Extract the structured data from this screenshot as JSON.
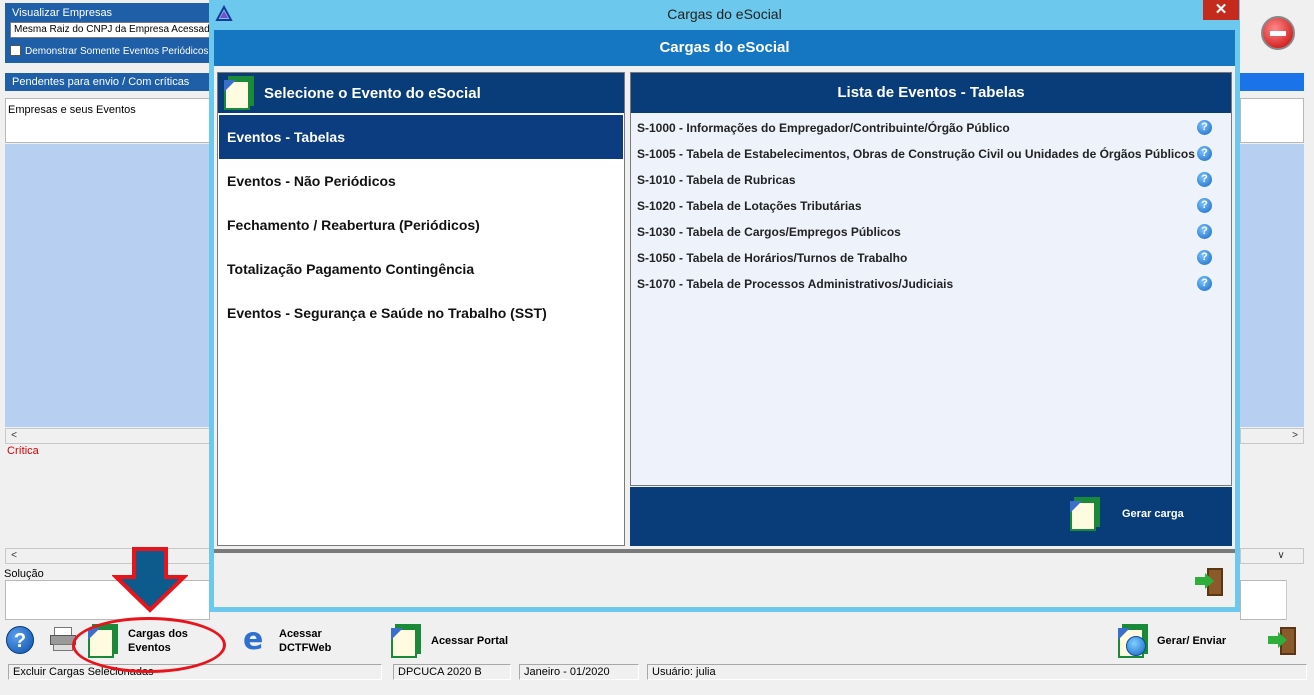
{
  "background": {
    "visualizar_label": "Visualizar Empresas",
    "visualizar_value": "Mesma Raiz do CNPJ da Empresa Acessada",
    "demonstrar_label": "Demonstrar Somente Eventos Periódicos",
    "pendentes_label": "Pendentes para envio / Com críticas",
    "grid_header": "Empresas e seus Eventos",
    "critica_label": "Crítica",
    "solucao_label": "Solução"
  },
  "toolbar": {
    "help_icon": "help-icon",
    "cargas_label_line1": "Cargas dos",
    "cargas_label_line2": "Eventos",
    "dctf_label_line1": "Acessar",
    "dctf_label_line2": "DCTFWeb",
    "portal_label": "Acessar Portal",
    "gerar_label": "Gerar/ Enviar"
  },
  "statusbar": {
    "message": "Excluir Cargas Selecionadas",
    "system": "DPCUCA 2020 B",
    "period": "Janeiro - 01/2020",
    "user": "Usuário: julia"
  },
  "dialog": {
    "window_title": "Cargas do eSocial",
    "close_glyph": "✕",
    "header": "Cargas do eSocial",
    "left_title": "Selecione o Evento do eSocial",
    "menu": [
      {
        "label": "Eventos - Tabelas",
        "selected": true
      },
      {
        "label": "Eventos - Não Periódicos",
        "selected": false
      },
      {
        "label": "Fechamento / Reabertura (Periódicos)",
        "selected": false
      },
      {
        "label": "Totalização Pagamento Contingência",
        "selected": false
      },
      {
        "label": "Eventos - Segurança e Saúde no Trabalho (SST)",
        "selected": false
      }
    ],
    "right_title": "Lista de Eventos - Tabelas",
    "events": [
      "S-1000 - Informações do Empregador/Contribuinte/Órgão Público",
      "S-1005 - Tabela de Estabelecimentos, Obras de Construção Civil ou Unidades de Órgãos Públicos",
      "S-1010 - Tabela de Rubricas",
      "S-1020 - Tabela de Lotações Tributárias",
      "S-1030 - Tabela de Cargos/Empregos Públicos",
      "S-1050 - Tabela de Horários/Turnos de Trabalho",
      "S-1070 - Tabela de Processos Administrativos/Judiciais"
    ],
    "gerar_carga_label": "Gerar carga",
    "help_glyph": "?"
  },
  "colors": {
    "dialog_frame": "#6cc8ec",
    "dialog_header": "#1577c2",
    "panel_header": "#083d7a",
    "annotation_red": "#e8141b",
    "annotation_arrow": "#0d5a8c"
  }
}
